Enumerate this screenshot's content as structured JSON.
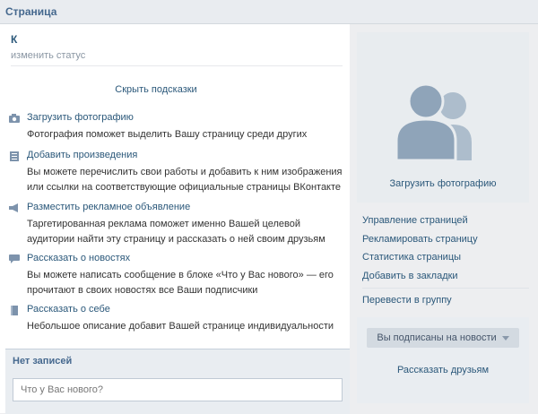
{
  "header": {
    "title": "Страница"
  },
  "profile": {
    "name": "К",
    "status_placeholder": "изменить статус"
  },
  "hints": {
    "hide_label": "Скрыть подсказки",
    "items": [
      {
        "icon": "camera-icon",
        "title": "Загрузить фотографию",
        "desc": "Фотография поможет выделить Вашу страницу среди других"
      },
      {
        "icon": "book-icon",
        "title": "Добавить произведения",
        "desc": "Вы можете перечислить свои работы и добавить к ним изображения или ссылки на соответствующие официальные страницы ВКонтакте"
      },
      {
        "icon": "megaphone-icon",
        "title": "Разместить рекламное объявление",
        "desc": "Таргетированная реклама поможет именно Вашей целевой аудитории найти эту страницу и рассказать о ней своим друзьям"
      },
      {
        "icon": "speech-bubble-icon",
        "title": "Рассказать о новостях",
        "desc": "Вы можете написать сообщение в блоке «Что у Вас нового» — его прочитают в своих новостях все Ваши подписчики"
      },
      {
        "icon": "document-icon",
        "title": "Рассказать о себе",
        "desc": "Небольшое описание добавит Вашей странице индивидуальности"
      }
    ]
  },
  "wall": {
    "title": "Нет записей",
    "placeholder": "Что у Вас нового?"
  },
  "sidebar": {
    "upload_photo": "Загрузить фотографию",
    "menu": [
      "Управление страницей",
      "Рекламировать страницу",
      "Статистика страницы",
      "Добавить в закладки"
    ],
    "convert": "Перевести в группу",
    "subscribe_label": "Вы подписаны на новости",
    "tell_friends": "Рассказать друзьям"
  },
  "colors": {
    "link": "#2b587a",
    "header_text": "#45688e",
    "panel_bg": "#e8ecef",
    "icon": "#7d93ac"
  }
}
